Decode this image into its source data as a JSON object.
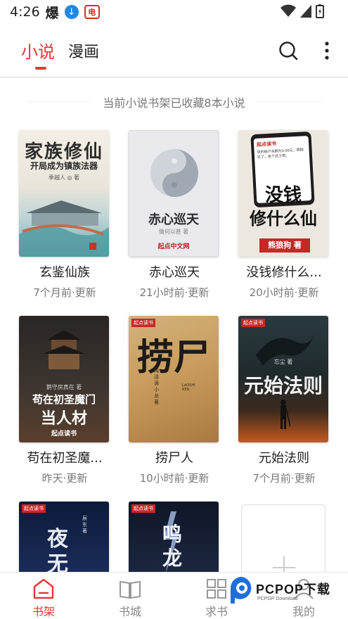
{
  "status_bar": {
    "time": "4:26",
    "app_text": "爆",
    "download_icon": "download-circle-icon",
    "red_icon_text": "电"
  },
  "top_tabs": [
    {
      "label": "小说",
      "active": true
    },
    {
      "label": "漫画",
      "active": false
    }
  ],
  "actions": {
    "search_icon": "search-icon",
    "more_icon": "more-vertical-icon"
  },
  "shelf": {
    "info": "当前小说书架已收藏8本小说",
    "books": [
      {
        "title": "玄鉴仙族",
        "meta": "7个月前·更新",
        "cover_text": "家族修仙",
        "cover_sub": "开局成为镇族法器",
        "cover_author": "季越人 ◎ 著"
      },
      {
        "title": "赤心巡天",
        "meta": "21小时前·更新",
        "cover_text": "赤心巡天",
        "cover_author": "情何以甚 著",
        "cover_brand": "起点中文网"
      },
      {
        "title": "没钱修什么...",
        "meta": "20小时前·更新",
        "cover_text": "没钱修什么仙",
        "cover_line1": "没钱",
        "cover_line2": "修什么仙",
        "cover_author": "熊狼狗 著",
        "cover_brand": "起点读书",
        "cover_phone_text": "您的账户余额为0.00元，照顾钉了，犹个还土吧。"
      },
      {
        "title": "苟在初圣魔...",
        "meta": "昨天·更新",
        "cover_text": "苟在初圣魔门当人材",
        "cover_line1": "苟在初圣魔门",
        "cover_line2": "当人材",
        "cover_author": "鹅守房真在 著",
        "cover_brand": "起点读书"
      },
      {
        "title": "捞尸人",
        "meta": "10小时前·更新",
        "cover_text": "捞尸",
        "cover_sub": "纯洁滴小龙 著",
        "cover_brand": "起点读书",
        "cover_en": "LAOSHI REN"
      },
      {
        "title": "元始法则",
        "meta": "7个月前·更新",
        "cover_text": "元始法则",
        "cover_author": "忘尘 著",
        "cover_brand": "起点读书"
      },
      {
        "title": "",
        "meta": "",
        "cover_text": "夜无",
        "cover_author": "辰东 著",
        "cover_brand": "起点读书"
      },
      {
        "title": "",
        "meta": "",
        "cover_text": "鸣龙",
        "cover_brand": "起点读书"
      }
    ]
  },
  "bottom_nav": [
    {
      "label": "书架",
      "icon": "bookshelf-icon",
      "active": true
    },
    {
      "label": "书城",
      "icon": "book-open-icon",
      "active": false
    },
    {
      "label": "求书",
      "icon": "grid-icon",
      "active": false
    },
    {
      "label": "我的",
      "icon": "user-icon",
      "active": false
    }
  ],
  "watermark": {
    "text": "PCPOP下载",
    "sub": "PCPOP Download"
  },
  "colors": {
    "accent": "#e53935",
    "muted": "#777777"
  }
}
